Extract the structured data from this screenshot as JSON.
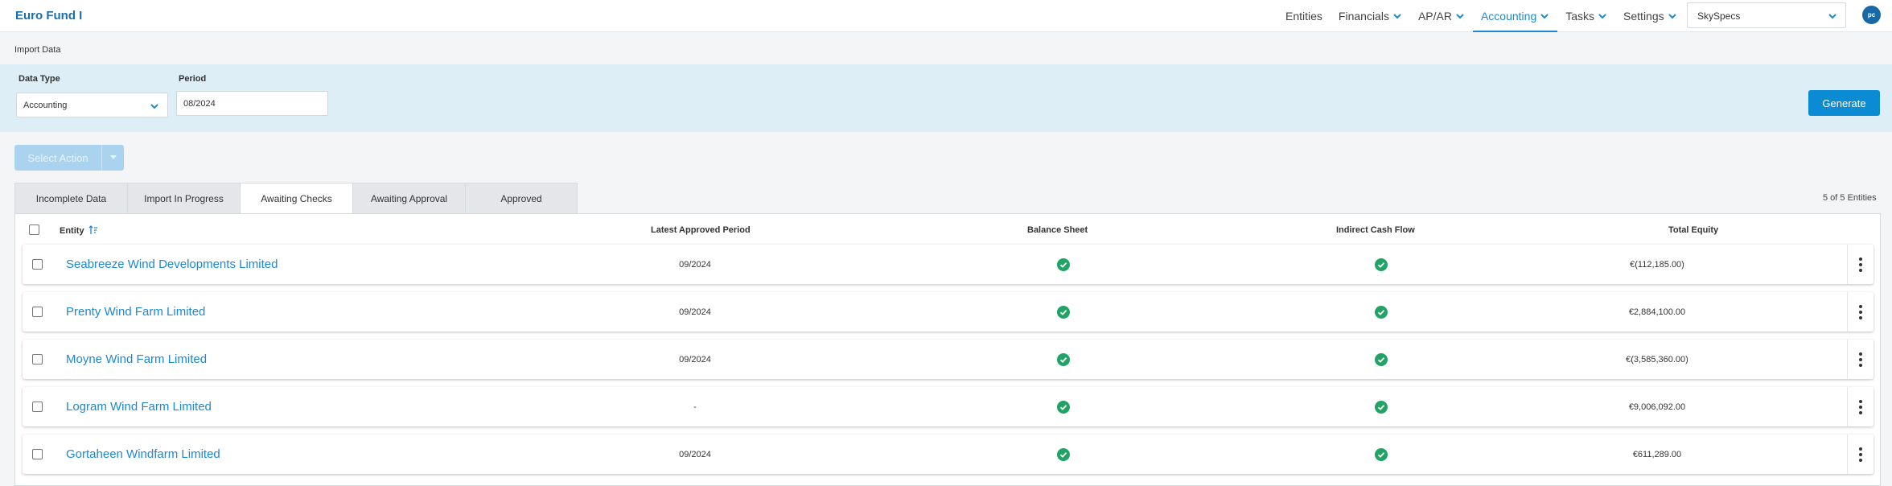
{
  "app": {
    "fund_name": "Euro Fund I",
    "org": "SkySpecs",
    "user_initials": "pc"
  },
  "nav": [
    {
      "label": "Entities",
      "dropdown": false,
      "active": false
    },
    {
      "label": "Financials",
      "dropdown": true,
      "active": false
    },
    {
      "label": "AP/AR",
      "dropdown": true,
      "active": false
    },
    {
      "label": "Accounting",
      "dropdown": true,
      "active": true
    },
    {
      "label": "Tasks",
      "dropdown": true,
      "active": false
    },
    {
      "label": "Settings",
      "dropdown": true,
      "active": false
    }
  ],
  "page": {
    "title": "Import Data"
  },
  "filters": {
    "data_type_label": "Data Type",
    "data_type_value": "Accounting",
    "period_label": "Period",
    "period_value": "08/2024",
    "generate_label": "Generate"
  },
  "actions": {
    "select_action_label": "Select Action"
  },
  "tabs": [
    {
      "label": "Incomplete Data",
      "active": false
    },
    {
      "label": "Import In Progress",
      "active": false
    },
    {
      "label": "Awaiting Checks",
      "active": true
    },
    {
      "label": "Awaiting Approval",
      "active": false
    },
    {
      "label": "Approved",
      "active": false
    }
  ],
  "entity_count": "5 of 5 Entities",
  "table": {
    "headers": {
      "entity": "Entity",
      "latest_period": "Latest Approved Period",
      "balance_sheet": "Balance Sheet",
      "cash_flow": "Indirect Cash Flow",
      "total_equity": "Total Equity"
    },
    "rows": [
      {
        "entity": "Seabreeze Wind Developments Limited",
        "latest_period": "09/2024",
        "balance_sheet": "ok",
        "cash_flow": "ok",
        "total_equity": "€(112,185.00)"
      },
      {
        "entity": "Prenty Wind Farm Limited",
        "latest_period": "09/2024",
        "balance_sheet": "ok",
        "cash_flow": "ok",
        "total_equity": "€2,884,100.00"
      },
      {
        "entity": "Moyne Wind Farm Limited",
        "latest_period": "09/2024",
        "balance_sheet": "ok",
        "cash_flow": "ok",
        "total_equity": "€(3,585,360.00)"
      },
      {
        "entity": "Logram Wind Farm Limited",
        "latest_period": "-",
        "balance_sheet": "ok",
        "cash_flow": "ok",
        "total_equity": "€9,006,092.00"
      },
      {
        "entity": "Gortaheen Windfarm Limited",
        "latest_period": "09/2024",
        "balance_sheet": "ok",
        "cash_flow": "ok",
        "total_equity": "€611,289.00"
      }
    ]
  },
  "colors": {
    "accent": "#1e88d1",
    "success": "#21a366",
    "filter_band": "#ddeef6"
  }
}
